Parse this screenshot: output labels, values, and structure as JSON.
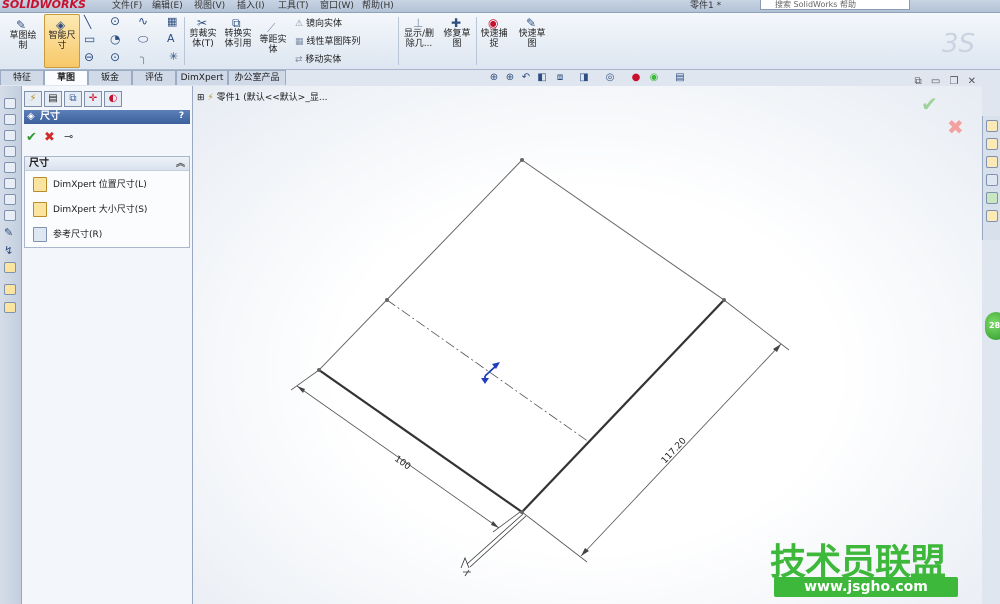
{
  "app": {
    "logo": "SOLIDWORKS",
    "search_placeholder": "搜索 SolidWorks 帮助",
    "doc_title": "零件1 *",
    "logo_3ds": "3S"
  },
  "menu": [
    "文件(F)",
    "编辑(E)",
    "视图(V)",
    "插入(I)",
    "工具(T)",
    "窗口(W)",
    "帮助(H)"
  ],
  "ribbon": {
    "sketch_btn": "草图绘\n制",
    "smart_dim": "智能尺\n寸",
    "trim": "剪裁实\n体(T)",
    "convert": "转换实\n体引用",
    "offset": "等距实\n体",
    "mirror": "镜向实体",
    "linear_pattern": "线性草图阵列",
    "move": "移动实体",
    "show_delete": "显示/删\n除几...",
    "repair": "修复草\n图",
    "quick_snap": "快速捕\n捉",
    "rapid_sketch": "快速草\n图"
  },
  "tabs": [
    {
      "label": "特征",
      "active": false
    },
    {
      "label": "草图",
      "active": true
    },
    {
      "label": "钣金",
      "active": false
    },
    {
      "label": "评估",
      "active": false
    },
    {
      "label": "DimXpert",
      "active": false
    },
    {
      "label": "办公室产品",
      "active": false
    }
  ],
  "property_manager": {
    "title": "尺寸",
    "help": "?",
    "group_title": "尺寸",
    "items": [
      {
        "label": "DimXpert 位置尺寸(L)",
        "icon": "location-dim-icon"
      },
      {
        "label": "DimXpert 大小尺寸(S)",
        "icon": "size-dim-icon"
      },
      {
        "label": "参考尺寸(R)",
        "icon": "reference-dim-icon"
      }
    ]
  },
  "viewport": {
    "tree_label": "零件1  (默认<<默认>_显...",
    "dim_left": "100",
    "dim_right": "117.20"
  },
  "watermark": {
    "text": "技术员联盟",
    "url": "www.jsgho.com"
  },
  "badge": "28",
  "colors": {
    "accent": "#3c609c",
    "ok": "#2e9a2b",
    "cancel": "#d12c2c",
    "watermark": "#3db83a"
  }
}
